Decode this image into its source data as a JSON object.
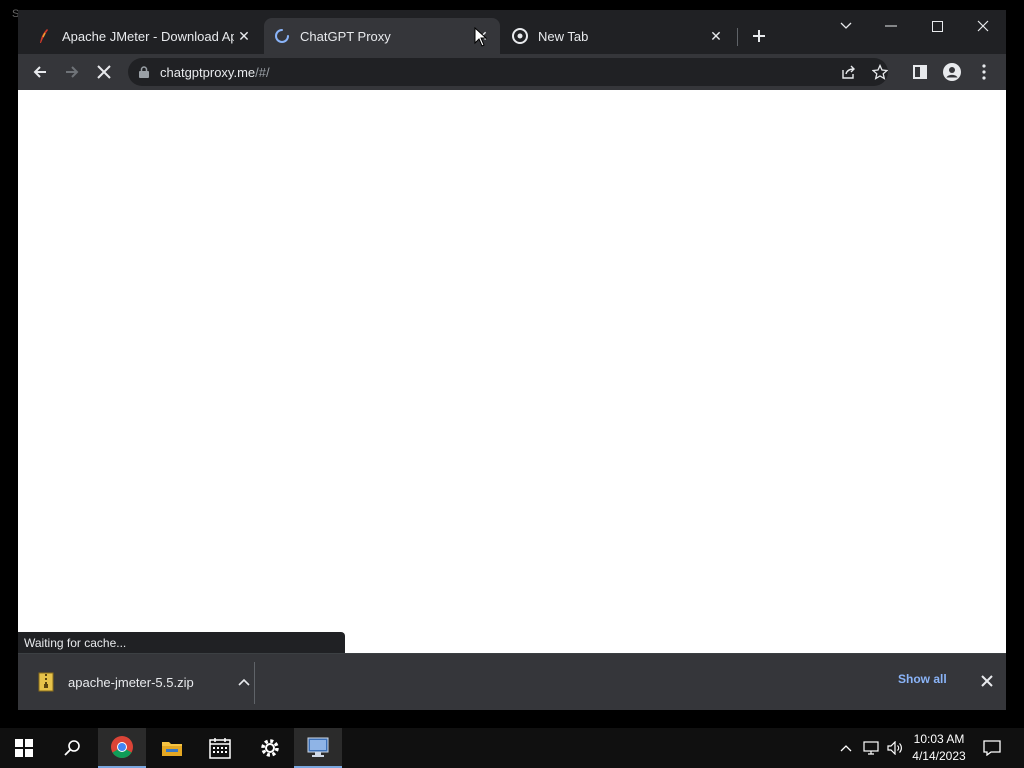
{
  "browser": {
    "tabs": [
      {
        "title": "Apache JMeter - Download Apac",
        "icon": "jmeter-feather-icon"
      },
      {
        "title": "ChatGPT Proxy",
        "icon": "loading-spinner-icon",
        "active": true
      },
      {
        "title": "New Tab",
        "icon": "chrome-icon"
      }
    ],
    "address": {
      "host": "chatgptproxy.me",
      "path": "/#/"
    },
    "status_text": "Waiting for cache..."
  },
  "downloads": {
    "items": [
      {
        "filename": "apache-jmeter-5.5.zip"
      }
    ],
    "show_all_label": "Show all"
  },
  "taskbar": {
    "time": "10:03 AM",
    "date": "4/14/2023"
  },
  "colors": {
    "chrome_dark": "#202124",
    "toolbar": "#35363a",
    "link_blue": "#8ab4f8"
  }
}
